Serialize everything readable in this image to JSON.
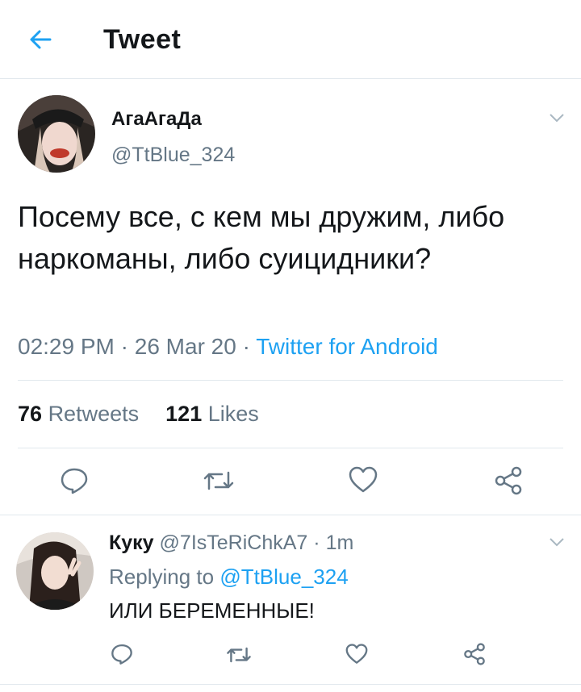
{
  "header": {
    "title": "Tweet",
    "back_icon": "arrow-left-icon"
  },
  "tweet": {
    "display_name": "АгаАгаДа",
    "handle": "@TtBlue_324",
    "text": "Посему все, с кем мы дружим, либо наркоманы, либо суицидники?",
    "time": "02:29 PM",
    "date": "26 Mar 20",
    "source": "Twitter for Android",
    "retweets_count": "76",
    "retweets_label": "Retweets",
    "likes_count": "121",
    "likes_label": "Likes"
  },
  "reply": {
    "display_name": "Куку",
    "handle": "@7IsTeRiChkA7",
    "time": "1m",
    "replying_prefix": "Replying to",
    "replying_to": "@TtBlue_324",
    "text": "ИЛИ БЕРЕМЕННЫЕ!"
  },
  "colors": {
    "accent": "#1da1f2",
    "secondary_text": "#657786",
    "divider": "#e1e8ed"
  }
}
